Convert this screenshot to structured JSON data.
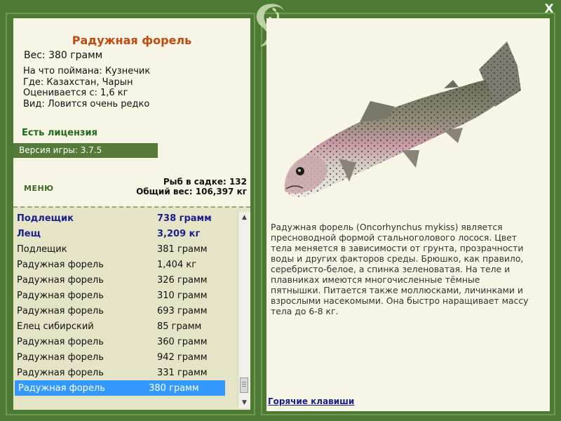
{
  "window": {
    "close_label": "X",
    "logo_icon": "fish-logo-icon"
  },
  "fish": {
    "name": "Радужная форель",
    "weight": "Вес: 380 грамм",
    "bait": "На что поймана: Кузнечик",
    "location": "Где: Казахстан, Чарын",
    "valued_from": "Оценивается с: 1,6 кг",
    "rarity": "Вид: Ловится очень редко"
  },
  "license": "Есть лицензия",
  "version": "Версия игры: 3.7.5",
  "menu_label": "МЕНЮ",
  "stats": {
    "fish_count": "Рыб в садке: 132",
    "total_weight": "Общий вес: 106,397 кг"
  },
  "catch_list": [
    {
      "name": "Подлещик",
      "weight": "738 грамм",
      "bold": true
    },
    {
      "name": "Лещ",
      "weight": "3,209 кг",
      "bold": true
    },
    {
      "name": "Подлещик",
      "weight": "381 грамм"
    },
    {
      "name": "Радужная форель",
      "weight": "1,404 кг"
    },
    {
      "name": "Радужная форель",
      "weight": "326 грамм"
    },
    {
      "name": "Радужная форель",
      "weight": "310 грамм"
    },
    {
      "name": "Радужная форель",
      "weight": "693 грамм"
    },
    {
      "name": "Елец сибирский",
      "weight": "85 грамм"
    },
    {
      "name": "Радужная форель",
      "weight": "360 грамм"
    },
    {
      "name": "Радужная форель",
      "weight": "942 грамм"
    },
    {
      "name": "Радужная форель",
      "weight": "331 грамм"
    },
    {
      "name": "Радужная форель",
      "weight": "380 грамм",
      "selected": true
    }
  ],
  "description": "Радужная форель (Oncorhynchus mykiss) является пресноводной формой стальноголового лосося. Цвет тела меняется в зависимости от грунта, прозрачности воды и других факторов среды. Брюшко, как правило, серебристо-белое, а спинка зеленоватая. На теле и плавниках имеются многочисленные тёмные пятнышки. Питается также моллюсками, личинками и взрослыми насекомыми. Она быстро наращивает массу тела до 6-8 кг.",
  "hotkeys_label": "Горячие клавиши",
  "colors": {
    "frame": "#4d7a32",
    "panel": "#f7f6e6",
    "list_bg": "#e6e4c6",
    "fish_name": "#c04a12",
    "selected": "#3399ff"
  }
}
